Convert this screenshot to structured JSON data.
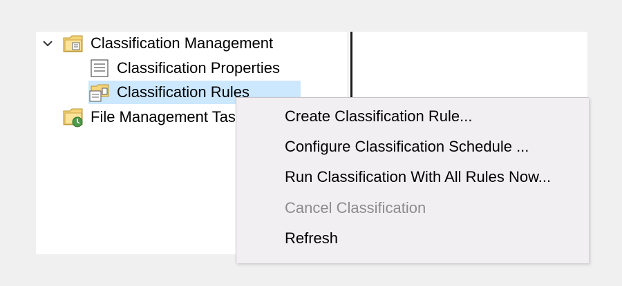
{
  "tree": {
    "items": [
      {
        "label": "Classification Management",
        "icon": "folder-icon",
        "expanded": true
      },
      {
        "label": "Classification Properties",
        "icon": "properties-icon"
      },
      {
        "label": "Classification Rules",
        "icon": "rules-icon",
        "selected": true
      },
      {
        "label": "File Management Tasks",
        "icon": "folder-task-icon"
      }
    ]
  },
  "context_menu": {
    "items": [
      {
        "label": "Create Classification Rule...",
        "enabled": true
      },
      {
        "label": "Configure Classification Schedule ...",
        "enabled": true
      },
      {
        "label": "Run Classification With All Rules Now...",
        "enabled": true
      },
      {
        "label": "Cancel Classification",
        "enabled": false
      },
      {
        "label": "Refresh",
        "enabled": true
      }
    ]
  },
  "colors": {
    "selection": "#cce8ff",
    "menu_background": "#f2eff2",
    "disabled_text": "#8c8c8c"
  }
}
